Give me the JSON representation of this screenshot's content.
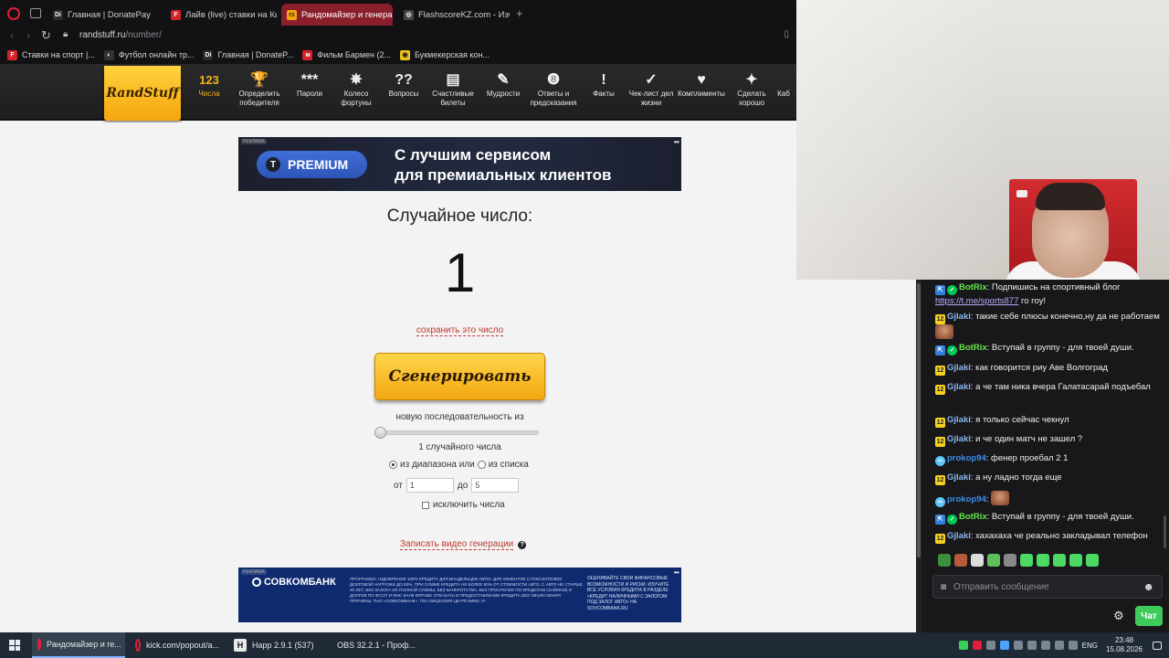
{
  "browser": {
    "tabs": [
      {
        "label": "Главная | DonatePay",
        "favicon": "Di",
        "fav_color": "#2b2b2b"
      },
      {
        "label": "Лайв (live) ставки на Киб",
        "favicon": "F",
        "fav_color": "#d2232a"
      },
      {
        "label": "Рандомайзер и генератор",
        "favicon": "rs",
        "fav_color": "#f5a50f"
      },
      {
        "label": "FlashscoreKZ.com - Избра",
        "favicon": "◎",
        "fav_color": "#444"
      }
    ],
    "new_tab": "+",
    "url_host": "randstuff.ru",
    "url_path": "/number/",
    "bookmarks": [
      {
        "label": "Ставки на спорт |...",
        "fav_color": "#d2232a",
        "favicon": "F"
      },
      {
        "label": "Футбол онлайн тр...",
        "fav_color": "#333",
        "favicon": "◐"
      },
      {
        "label": "Главная | DonateP...",
        "fav_color": "#2b2b2b",
        "favicon": "Di"
      },
      {
        "label": "Фильм Бармен (2...",
        "fav_color": "#d2232a",
        "favicon": "м"
      },
      {
        "label": "Букмекерская кон...",
        "fav_color": "#e8c21a",
        "favicon": "◉"
      }
    ]
  },
  "site": {
    "logo": "RandStuff",
    "nav": [
      {
        "icon": "123",
        "label": "Числа",
        "active": true
      },
      {
        "icon": "🏆",
        "label": "Определить победителя"
      },
      {
        "icon": "***",
        "label": "Пароли"
      },
      {
        "icon": "✵",
        "label": "Колесо фортуны"
      },
      {
        "icon": "??",
        "label": "Вопросы"
      },
      {
        "icon": "▤",
        "label": "Счастливые билеты"
      },
      {
        "icon": "✎",
        "label": "Мудрости"
      },
      {
        "icon": "❽",
        "label": "Ответы и предсказания"
      },
      {
        "icon": "!",
        "label": "Факты"
      },
      {
        "icon": "✓",
        "label": "Чек-лист дел жизни"
      },
      {
        "icon": "♥",
        "label": "Комплименты"
      },
      {
        "icon": "✦",
        "label": "Сделать хорошо"
      },
      {
        "icon": "",
        "label": "Каб"
      }
    ]
  },
  "ad_top": {
    "mark": "РЕКЛАМА",
    "badge": "T",
    "pill": "PREMIUM",
    "line1": "С лучшим сервисом",
    "line2": "для премиальных клиентов",
    "colors": {
      "pill": "#3f6fd8",
      "bg": "#1b1f2e"
    }
  },
  "generator": {
    "title": "Случайное число:",
    "result": "1",
    "save_link": "сохранить это число",
    "button": "Сгенерировать",
    "sequence_label": "новую последовательность из",
    "count_label": "1 случайного числа",
    "mode_range": "из диапазона или",
    "mode_list": "из списка",
    "from_label": "от",
    "from_value": "1",
    "to_label": "до",
    "to_value": "5",
    "exclude_label": "исключить числа",
    "video_link": "Записать видео генерации",
    "help": "?",
    "accent": "#c0392b"
  },
  "ad_bottom": {
    "mark": "РЕКЛАМА",
    "brand": "СОВКОМБАНК",
    "small_text": "ПРОГРАММА «ОДОБРЕНИЕ 100% КРЕДИТА ДЛЯ ВЛАДЕЛЬЦЕВ АВТО» ДЛЯ КЛИЕНТОВ С ПОКАЗАТЕЛЕМ ДОЛГОВОЙ НАГРУЗКИ ДО 50%, ПРИ СУММЕ КРЕДИТА НЕ БОЛЕЕ 80% ОТ СТОИМОСТИ АВТО, С АВТО НЕ СТАРШЕ 20 ЛЕТ, БЕЗ ЗАЛОГА ИХ ПОЛНОЙ СУММЫ, БЕЗ БАНКРОТСТВА, БЕЗ ПРОСРОЧЕК ПО КРЕДИТАМ (ЗАЙМАМ) И ДОЛГОВ ПО ФССП И ФНС БАНК ВПРАВЕ ОТКАЗАТЬ В ПРЕДОСТАВЛЕНИИ КРЕДИТА БЕЗ ОБЪЯСНЕНИЯ ПРИЧИНЫ. ПАО «СОВКОМБАНК». ГЕН.ЛИЦЕНЗИЯ ЦБ РФ №963. 0+",
    "right_text": "ОЦЕНИВАЙТЕ СВОИ ФИНАНСОВЫЕ ВОЗМОЖНОСТИ И РИСКИ. ИЗУЧИТЕ ВСЕ УСЛОВИЯ КРЕДИТА В РАЗДЕЛЕ «КРЕДИТ НАЛИЧНЫМИ С ЗАЛОГОМ ПОД ЗАЛОГ АВТО» НА SOVCOMBANK.RU"
  },
  "chat": {
    "messages": [
      {
        "badges": [
          "mod",
          "ver"
        ],
        "user": "BotRix",
        "user_class": "u-botrix",
        "text": "Подпишись на спортивный блог ",
        "link": "https://t.me/sports877",
        "text2": " го гоу!"
      },
      {
        "badges": [
          "num"
        ],
        "user": "Gjlaki",
        "user_class": "u-gjlaki",
        "text": "такие себе плюсы конечно,ну да не работаем",
        "emote": true
      },
      {
        "badges": [
          "mod",
          "ver"
        ],
        "user": "BotRix",
        "user_class": "u-botrix",
        "text": "Вступай в группу - для твоей души."
      },
      {
        "badges": [
          "num"
        ],
        "user": "Gjlaki",
        "user_class": "u-gjlaki",
        "text": "как говорится риу Аве Волгоград"
      },
      {
        "badges": [
          "num"
        ],
        "user": "Gjlaki",
        "user_class": "u-gjlaki",
        "text": "а че там ника вчера Галатасарай подъебал"
      },
      {
        "badges": [
          "num"
        ],
        "user": "Gjlaki",
        "user_class": "u-gjlaki",
        "text": "я только сейчас чекнул"
      },
      {
        "badges": [
          "num"
        ],
        "user": "Gjlaki",
        "user_class": "u-gjlaki",
        "text": "и че один матч не зашел ?"
      },
      {
        "badges": [
          "sub"
        ],
        "user": "prokop94",
        "user_class": "u-prokop",
        "text": "фенер проебал 2 1"
      },
      {
        "badges": [
          "num"
        ],
        "user": "Gjlaki",
        "user_class": "u-gjlaki",
        "text": "а ну ладно тогда еще"
      },
      {
        "badges": [
          "sub"
        ],
        "user": "prokop94",
        "user_class": "u-prokop",
        "text": "",
        "emote": true
      },
      {
        "badges": [
          "mod",
          "ver"
        ],
        "user": "BotRix",
        "user_class": "u-botrix",
        "text": "Вступай в группу - для твоей души."
      },
      {
        "badges": [
          "num"
        ],
        "user": "Gjlaki",
        "user_class": "u-gjlaki",
        "text": "хахахаха че реально закладывал телефон"
      }
    ],
    "badge_text": {
      "num": "12",
      "mod": "⇱",
      "ver": "✓",
      "sub": "∞"
    },
    "input_placeholder": "Отправить сообщение",
    "send_button": "Чат",
    "emote_colors": [
      "#3a8f3a",
      "#b55a3a",
      "#dcdcdc",
      "#5fbf5a",
      "#888",
      "#4cd964",
      "#4cd964",
      "#4cd964",
      "#4cd964",
      "#4cd964"
    ]
  },
  "taskbar": {
    "apps": [
      {
        "label": "Рандомайзер и ге...",
        "icon": "opera",
        "active": true
      },
      {
        "label": "kick.com/popout/a...",
        "icon": "opera"
      },
      {
        "label": "Happ 2.9.1 (537)",
        "icon": "H"
      },
      {
        "label": "OBS 32.2.1 - Проф...",
        "icon": "obs"
      }
    ],
    "lang": "ENG",
    "time": "23:48",
    "date": "15.08.2026"
  }
}
